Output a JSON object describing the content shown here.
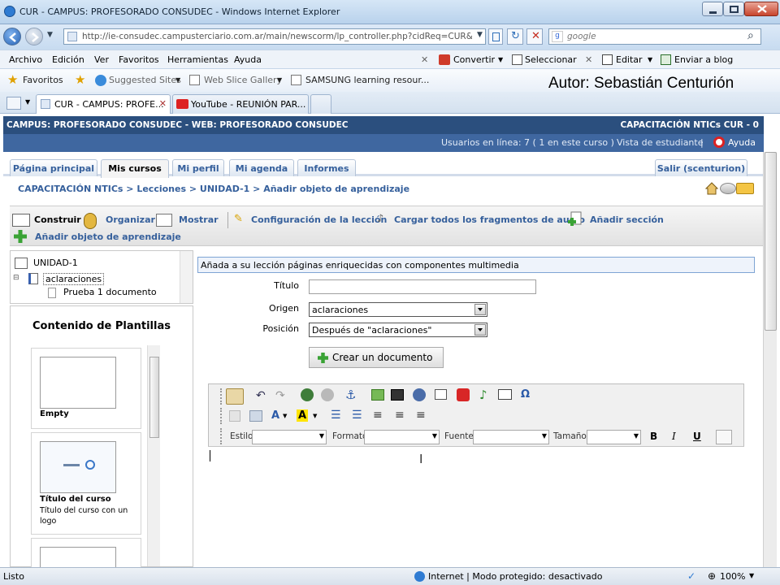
{
  "window": {
    "title": "CUR - CAMPUS: PROFESORADO CONSUDEC - Windows Internet Explorer"
  },
  "address": {
    "url": "http://ie-consudec.campusterciario.com.ar/main/newscorm/lp_controller.php?cidReq=CUR&ac",
    "search_placeholder": "google"
  },
  "menu": {
    "items": [
      "Archivo",
      "Edición",
      "Ver",
      "Favoritos",
      "Herramientas",
      "Ayuda"
    ],
    "convert": "Convertir",
    "select": "Seleccionar",
    "edit": "Editar",
    "send_blog": "Enviar a blog"
  },
  "favorites": {
    "label": "Favoritos",
    "suggested": "Suggested Sites",
    "webslice": "Web Slice Gallery",
    "samsung": "SAMSUNG learning resour..."
  },
  "author_overlay": "Autor: Sebastián Centurión",
  "browser_tabs": [
    "CUR - CAMPUS: PROFE...",
    "YouTube - REUNIÓN PAR..."
  ],
  "page": {
    "header_left": "CAMPUS: PROFESORADO CONSUDEC - WEB: PROFESORADO CONSUDEC",
    "header_right": "CAPACITACIÓN NTICs CUR - 0",
    "users_online": "Usuarios en línea: 7  ( 1 en este curso  )",
    "student_view": "Vista de estudiante",
    "help": "Ayuda",
    "tabs": [
      "Página principal",
      "Mis cursos",
      "Mi perfil",
      "Mi agenda",
      "Informes"
    ],
    "logout": "Salir (scenturion)",
    "breadcrumb": "CAPACITACIÓN NTICs > Lecciones > UNIDAD-1 > Añadir objeto de aprendizaje"
  },
  "toolbar": {
    "build": "Construir",
    "organize": "Organizar",
    "show": "Mostrar",
    "config": "Configuración de la lección",
    "upload_audio": "Cargar todos los fragmentos de audio",
    "add_section": "Añadir sección",
    "add_object": "Añadir objeto de aprendizaje"
  },
  "tree": {
    "root": "UNIDAD-1",
    "child": "aclaraciones",
    "grandchild": "Prueba 1 documento"
  },
  "templates": {
    "heading": "Contenido de Plantillas",
    "items": [
      {
        "title": "Empty",
        "desc": ""
      },
      {
        "title": "Título del curso",
        "desc": "Título del curso con un logo"
      }
    ]
  },
  "form": {
    "info": "Añada a su lección páginas enriquecidas con componentes multimedia",
    "title_label": "Título",
    "title_value": "",
    "origin_label": "Origen",
    "origin_value": "aclaraciones",
    "position_label": "Posición",
    "position_value": "Después de \"aclaraciones\"",
    "create_button": "Crear un documento"
  },
  "editor": {
    "style_label": "Estilo",
    "format_label": "Formato",
    "font_label": "Fuente",
    "size_label": "Tamaño",
    "bold": "B",
    "italic": "I",
    "underline": "U"
  },
  "status": {
    "left": "Listo",
    "zone": "Internet | Modo protegido: desactivado",
    "zoom": "100%"
  },
  "colors": {
    "header_dark": "#2b4f7e",
    "header_light": "#3f67a0",
    "link_blue": "#36609c",
    "add_green": "#3aa335"
  }
}
